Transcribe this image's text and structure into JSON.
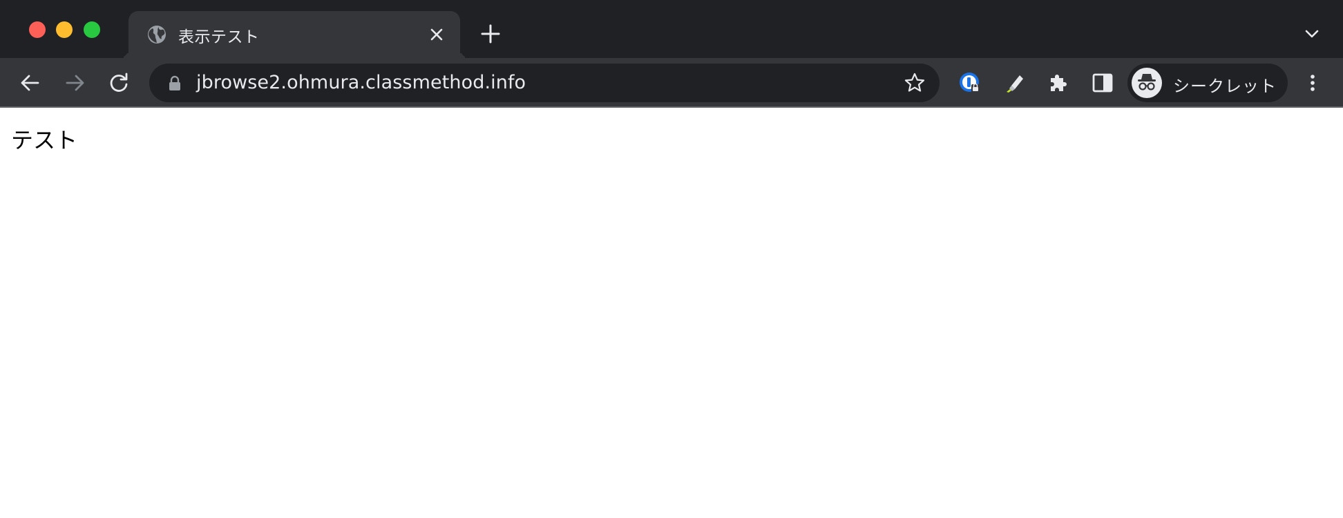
{
  "window": {
    "traffic_lights": [
      {
        "name": "close",
        "color": "#fe5f57"
      },
      {
        "name": "minimize",
        "color": "#febc2e"
      },
      {
        "name": "zoom",
        "color": "#28c840"
      }
    ]
  },
  "tab": {
    "title": "表示テスト",
    "favicon": "globe-icon",
    "close_icon": "close-icon"
  },
  "tabstrip": {
    "new_tab_icon": "plus-icon",
    "tab_search_icon": "chevron-down-icon"
  },
  "toolbar": {
    "back_icon": "arrow-left-icon",
    "forward_icon": "arrow-right-icon",
    "reload_icon": "reload-icon",
    "omnibox": {
      "url": "jbrowse2.ohmura.classmethod.info",
      "secure_icon": "lock-icon",
      "bookmark_icon": "star-icon"
    },
    "extensions": [
      {
        "name": "password-manager-icon"
      },
      {
        "name": "highlighter-icon"
      },
      {
        "name": "puzzle-icon"
      },
      {
        "name": "side-panel-icon"
      }
    ],
    "profile": {
      "label": "シークレット",
      "avatar_icon": "incognito-icon"
    },
    "menu_icon": "kebab-menu-icon"
  },
  "colors": {
    "tabstrip_bg": "#202124",
    "toolbar_bg": "#35363a",
    "omnibox_bg": "#202124",
    "text_light": "#e8eaed",
    "icon_disabled": "#80868b",
    "accent_blue": "#1a73e8"
  },
  "page": {
    "text": "テスト"
  }
}
